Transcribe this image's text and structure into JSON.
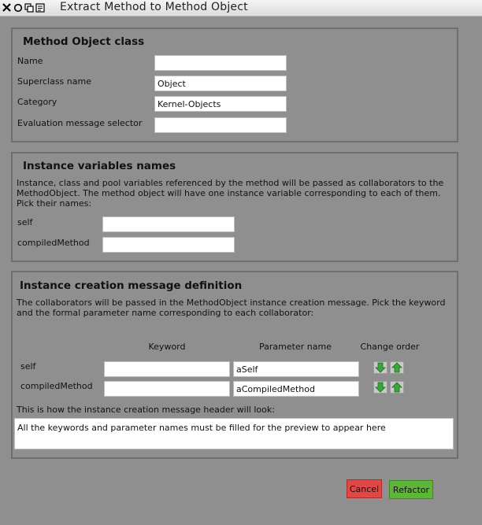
{
  "window": {
    "title": "Extract Method to Method Object",
    "controls": [
      "close-icon",
      "minimize-icon",
      "expand-icon",
      "menu-icon"
    ]
  },
  "method_object": {
    "title": "Method Object class",
    "fields": [
      {
        "label": "Name",
        "value": ""
      },
      {
        "label": "Superclass name",
        "value": "Object"
      },
      {
        "label": "Category",
        "value": "Kernel-Objects"
      },
      {
        "label": "Evaluation message selector",
        "value": ""
      }
    ]
  },
  "instance_variables": {
    "title": "Instance variables names",
    "description": "Instance, class and pool variables referenced by the method will be passed as collaborators to the MethodObject. The method object will have one instance variable corresponding to each of them. Pick their names:",
    "vars": [
      {
        "label": "self",
        "value": ""
      },
      {
        "label": "compiledMethod",
        "value": ""
      }
    ]
  },
  "creation_message": {
    "title": "Instance creation message definition",
    "description": "The collaborators will be passed in the MethodObject instance creation message. Pick the keyword and the formal parameter name corresponding to each collaborator:",
    "columns": {
      "keyword": "Keyword",
      "parameter": "Parameter name",
      "order": "Change order"
    },
    "rows": [
      {
        "label": "self",
        "keyword": "",
        "parameter": "aSelf"
      },
      {
        "label": "compiledMethod",
        "keyword": "",
        "parameter": "aCompiledMethod"
      }
    ],
    "preview_label": "This is how the instance creation message header will look:",
    "preview_text": "All the keywords and parameter names must be filled for the preview to appear here"
  },
  "buttons": {
    "cancel": "Cancel",
    "refactor": "Refactor"
  },
  "colors": {
    "cancel": "#e04848",
    "refactor": "#5fb43a",
    "arrow": "#3aa53a",
    "background": "#8f8f8f"
  }
}
